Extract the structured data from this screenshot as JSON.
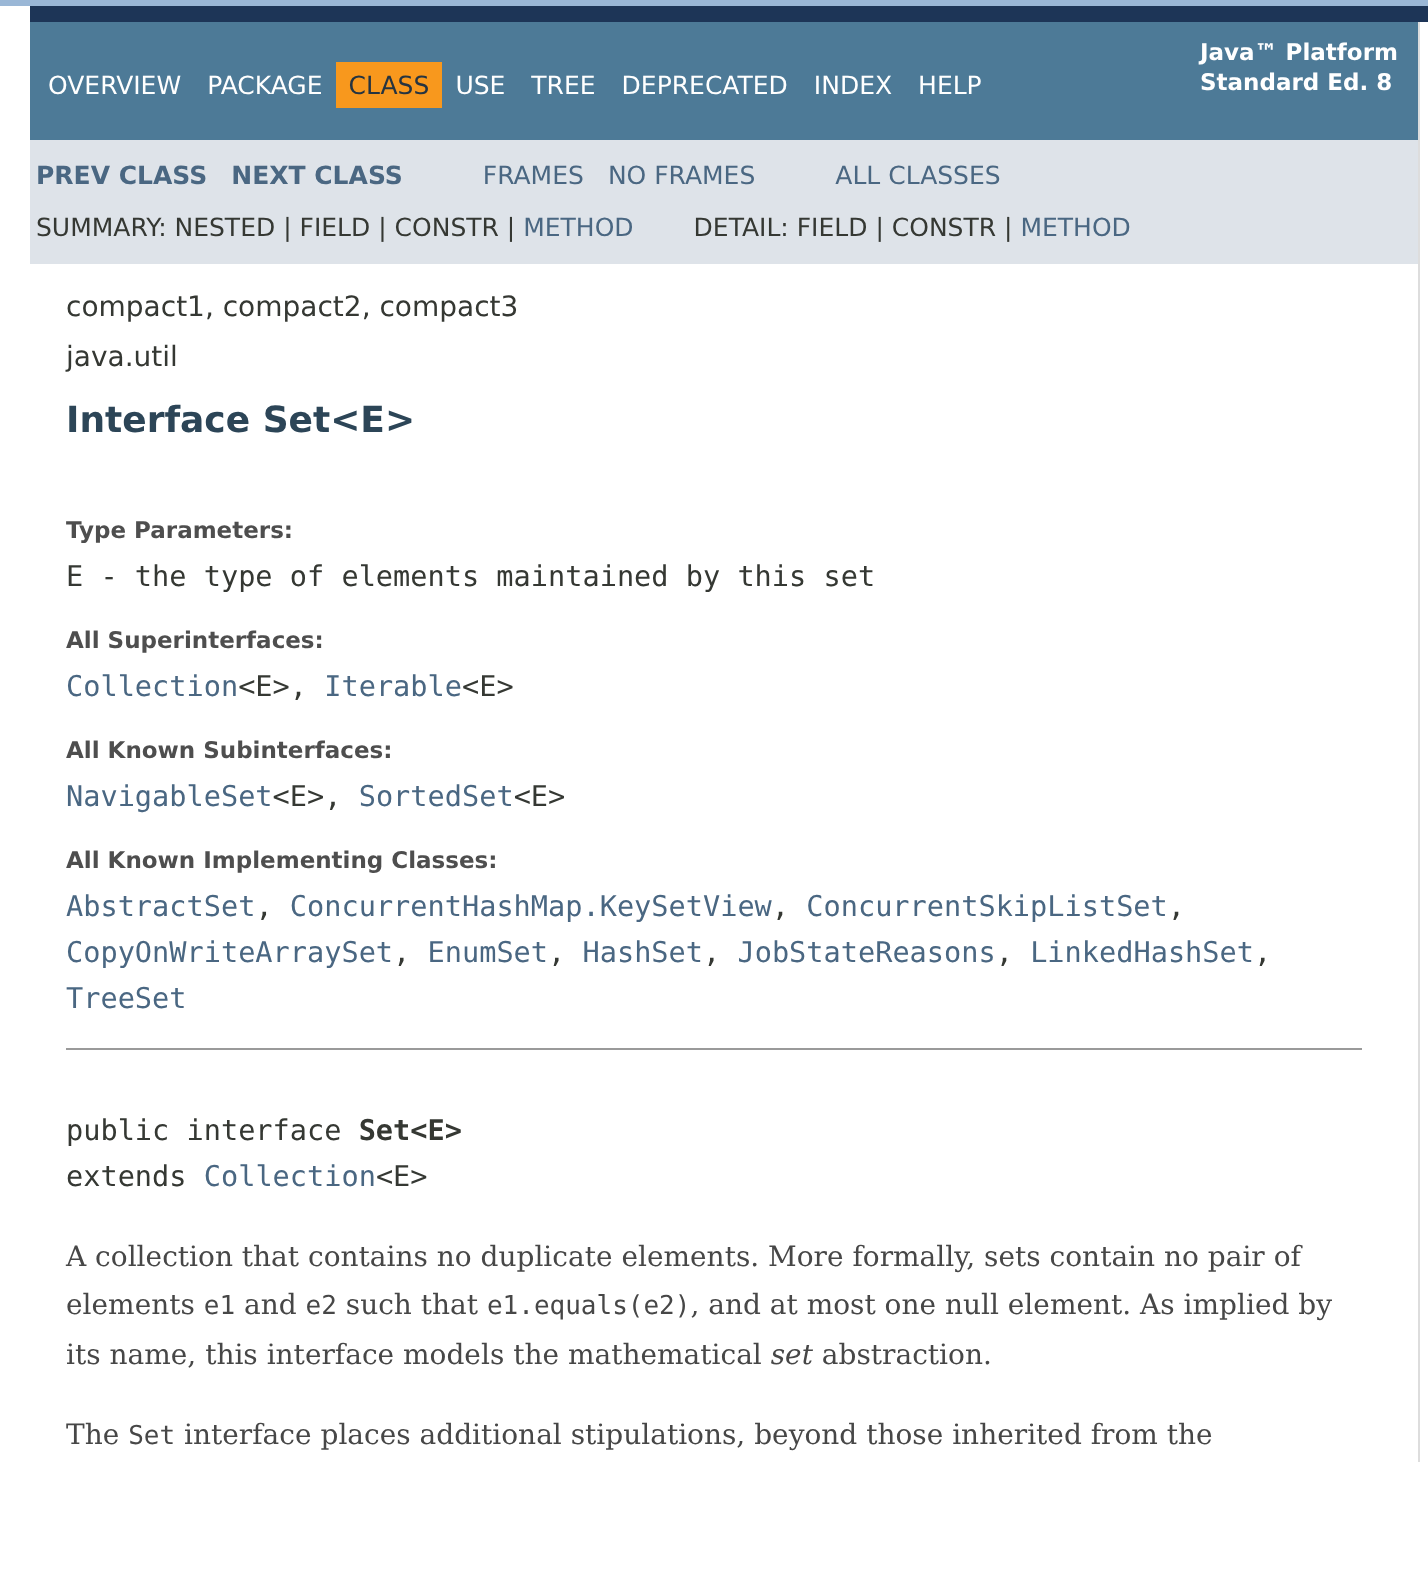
{
  "top_nav": {
    "items": [
      {
        "label": "OVERVIEW",
        "selected": false
      },
      {
        "label": "PACKAGE",
        "selected": false
      },
      {
        "label": "CLASS",
        "selected": true
      },
      {
        "label": "USE",
        "selected": false
      },
      {
        "label": "TREE",
        "selected": false
      },
      {
        "label": "DEPRECATED",
        "selected": false
      },
      {
        "label": "INDEX",
        "selected": false
      },
      {
        "label": "HELP",
        "selected": false
      }
    ],
    "about": [
      "Java™ Platform",
      "Standard Ed. 8"
    ]
  },
  "sub_nav": {
    "groups": [
      [
        {
          "label": "PREV CLASS",
          "kind": "bold"
        },
        {
          "label": "NEXT CLASS",
          "kind": "bold"
        }
      ],
      [
        {
          "label": "FRAMES",
          "kind": "link"
        },
        {
          "label": "NO FRAMES",
          "kind": "link"
        }
      ],
      [
        {
          "label": "ALL CLASSES",
          "kind": "link"
        }
      ]
    ],
    "summary_lines": [
      [
        {
          "text": "SUMMARY: NESTED | FIELD | CONSTR | ",
          "link": false
        },
        {
          "text": "METHOD",
          "link": true
        }
      ],
      [
        {
          "text": "DETAIL: FIELD | CONSTR | ",
          "link": false
        },
        {
          "text": "METHOD",
          "link": true
        }
      ]
    ]
  },
  "profiles": "compact1, compact2, compact3",
  "package": "java.util",
  "title": "Interface Set<E>",
  "sections": [
    {
      "heading": "Type Parameters:",
      "items": [
        {
          "text": "E - the type of elements maintained by this set"
        }
      ]
    },
    {
      "heading": "All Superinterfaces:",
      "items": [
        {
          "link": "Collection",
          "text": "<E>, "
        },
        {
          "link": "Iterable",
          "text": "<E>"
        }
      ]
    },
    {
      "heading": "All Known Subinterfaces:",
      "items": [
        {
          "link": "NavigableSet",
          "text": "<E>, "
        },
        {
          "link": "SortedSet",
          "text": "<E>"
        }
      ]
    },
    {
      "heading": "All Known Implementing Classes:",
      "items": [
        {
          "link": "AbstractSet",
          "text": ", "
        },
        {
          "link": "ConcurrentHashMap.KeySetView",
          "text": ", "
        },
        {
          "link": "ConcurrentSkipListSet",
          "text": ", "
        },
        {
          "link": "CopyOnWriteArraySet",
          "text": ", "
        },
        {
          "link": "EnumSet",
          "text": ", "
        },
        {
          "link": "HashSet",
          "text": ", "
        },
        {
          "link": "JobStateReasons",
          "text": ", "
        },
        {
          "link": "LinkedHashSet",
          "text": ", "
        },
        {
          "link": "TreeSet"
        }
      ]
    }
  ],
  "signature": {
    "declaration": "public interface **Set<E>**",
    "extends_prefix": "extends ",
    "extends_link": "Collection",
    "extends_suffix": "<E>"
  },
  "description": [
    [
      {
        "kind": "text",
        "text": "A collection that contains no duplicate elements. More formally, sets contain no pair of elements "
      },
      {
        "kind": "code",
        "text": "e1"
      },
      {
        "kind": "text",
        "text": " and "
      },
      {
        "kind": "code",
        "text": "e2"
      },
      {
        "kind": "text",
        "text": " such that "
      },
      {
        "kind": "code",
        "text": "e1.equals(e2)"
      },
      {
        "kind": "text",
        "text": ", and at most one null element. As implied by its name, this interface models the mathematical "
      },
      {
        "kind": "em",
        "text": "set"
      },
      {
        "kind": "text",
        "text": " abstraction."
      }
    ],
    [
      {
        "kind": "text",
        "text": "The "
      },
      {
        "kind": "code",
        "text": "Set"
      },
      {
        "kind": "text",
        "text": " interface places additional stipulations, beyond those inherited from the"
      }
    ]
  ]
}
